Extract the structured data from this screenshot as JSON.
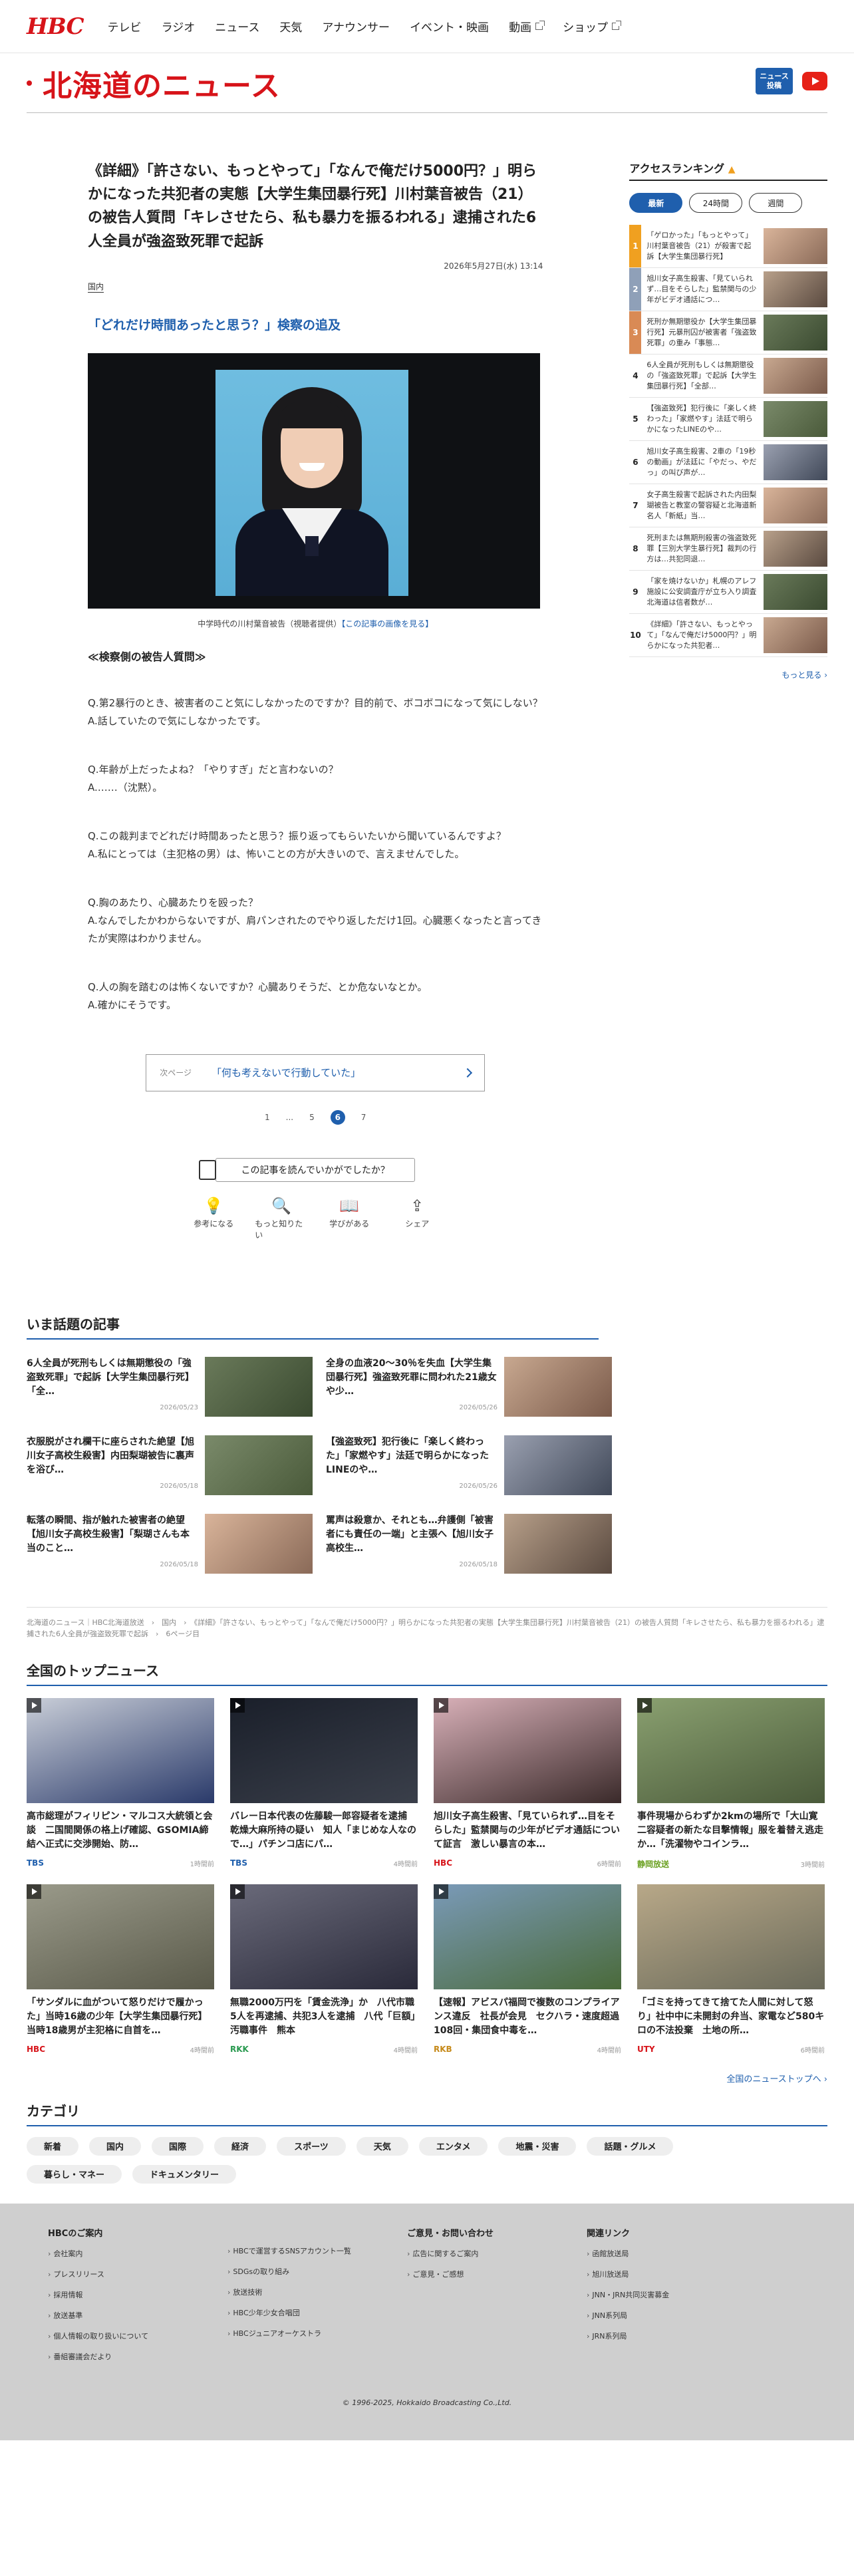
{
  "gnav": {
    "logo": "HBC",
    "items": [
      "テレビ",
      "ラジオ",
      "ニュース",
      "天気",
      "アナウンサー",
      "イベント・映画",
      "動画",
      "ショップ"
    ]
  },
  "section": {
    "title": "北海道のニュース",
    "badge_line1": "ニュース",
    "badge_line2": "投稿"
  },
  "article": {
    "title": "《詳細》「許さない、もっとやって」「なんで俺だけ5000円？」明らかになった共犯者の実態【大学生集団暴行死】川村葉音被告（21）の被告人質問「キレさせたら、私も暴力を振るわれる」逮捕された6人全員が強盗致死罪で起訴",
    "date": "2026年5月27日(水) 13:14",
    "category": "国内",
    "subtitle": "「どれだけ時間あったと思う？」検察の追及",
    "caption_text": "中学時代の川村葉音被告（視聴者提供）",
    "caption_link": "【この記事の画像を見る】",
    "qa_heading": "≪検察側の被告人質問≫",
    "qa": [
      {
        "q": "Q.第2暴行のとき、被害者のこと気にしなかったのですか？目的前で、ボコボコになって気にしない？",
        "a": "A.話していたので気にしなかったです。"
      },
      {
        "q": "Q.年齢が上だったよね？「やりすぎ」だと言わないの？",
        "a": "A.……（沈黙）。"
      },
      {
        "q": "Q.この裁判までどれだけ時間あったと思う？振り返ってもらいたいから聞いているんですよ？",
        "a": "A.私にとっては（主犯格の男）は、怖いことの方が大きいので、言えませんでした。"
      },
      {
        "q": "Q.胸のあたり、心臓あたりを殴った？",
        "a": "A.なんでしたかわからないですが、肩パンされたのでやり返しただけ1回。心臓悪くなったと言ってきたが実際はわかりません。"
      },
      {
        "q": "Q.人の胸を踏むのは怖くないですか？心臓ありそうだ、とか危ないなとか。",
        "a": "A.確かにそうです。"
      }
    ],
    "next_label": "次ページ",
    "next_title": "「何も考えないで行動していた」",
    "pager": [
      "1",
      "...",
      "5",
      "6",
      "7"
    ],
    "pager_current": "6",
    "feedback": "この記事を読んでいかがでしたか？",
    "reactions": [
      {
        "icon": "💡",
        "label": "参考になる"
      },
      {
        "icon": "🔍",
        "label": "もっと知りたい"
      },
      {
        "icon": "📖",
        "label": "学びがある"
      },
      {
        "icon": "⇪",
        "label": "シェア"
      }
    ]
  },
  "ranking": {
    "title": "アクセスランキング",
    "tabs": [
      "最新",
      "24時間",
      "週間"
    ],
    "items": [
      {
        "num": "1",
        "text": "「ゲロかった」「もっとやって」川村葉音被告（21）が殺害で起訴【大学生集団暴行死】",
        "color": "#f0a020"
      },
      {
        "num": "2",
        "text": "旭川女子高生殺害、「見ていられず…目をそらした」監禁関与の少年がビデオ通話につ…",
        "color": "#8fa0b8"
      },
      {
        "num": "3",
        "text": "死刑か無期懲役か【大学生集団暴行死】元暴刑囚が被害者「強盗致死罪」の重み「事態…",
        "color": "#d98a55"
      },
      {
        "num": "4",
        "text": "6人全員が死刑もしくは無期懲役の「強盗致死罪」で起訴【大学生集団暴行死】「全部…",
        "color": ""
      },
      {
        "num": "5",
        "text": "【強盗致死】犯行後に「楽しく終わった」「家燃やす」法廷で明らかになったLINEのや…",
        "color": ""
      },
      {
        "num": "6",
        "text": "旭川女子高生殺害、2車の「19秒の動画」が法廷に「やだっ、やだっ」の叫び声が…",
        "color": ""
      },
      {
        "num": "7",
        "text": "女子高生殺害で起訴された内田梨瑚被告と教室の警容疑と北海道新名人「新紙」当…",
        "color": ""
      },
      {
        "num": "8",
        "text": "死刑または無期刑殺害の強盗致死罪【三別大学生暴行死】裁判の行方は…共犯同退…",
        "color": ""
      },
      {
        "num": "9",
        "text": "「家を焼けないか」札幌のアレフ施設に公安調査庁が立ち入り調査 北海道は信者数が…",
        "color": ""
      },
      {
        "num": "10",
        "text": "《詳細》「許さない、もっとやって」「なんで俺だけ5000円？」明らかになった共犯者…",
        "color": ""
      }
    ],
    "more": "もっと見る ›"
  },
  "hot": {
    "title": "いま話題の記事",
    "items": [
      {
        "text": "6人全員が死刑もしくは無期懲役の「強盗致死罪」で起訴【大学生集団暴行死】「全…",
        "date": "2026/05/23"
      },
      {
        "text": "全身の血液20～30％を失血【大学生集団暴行死】強盗致死罪に問われた21歳女や少…",
        "date": "2026/05/26"
      },
      {
        "text": "衣服脱がされ欄干に座らされた絶望【旭川女子高校生殺害】内田梨瑚被告に裏声を浴び…",
        "date": "2026/05/18"
      },
      {
        "text": "【強盗致死】犯行後に「楽しく終わった」「家燃やす」法廷で明らかになったLINEのや…",
        "date": "2026/05/26"
      },
      {
        "text": "転落の瞬間、指が触れた被害者の絶望【旭川女子高校生殺害】「梨瑚さんも本当のこと…",
        "date": "2026/05/18"
      },
      {
        "text": "罵声は殺意か、それとも…弁護側「被害者にも責任の一端」と主張へ【旭川女子高校生…",
        "date": "2026/05/18"
      }
    ]
  },
  "breadcrumb": "北海道のニュース｜HBC北海道放送　›　国内　›　《詳細》「許さない、もっとやって」「なんで俺だけ5000円？」明らかになった共犯者の実態【大学生集団暴行死】川村葉音被告（21）の被告人質問「キレさせたら、私も暴力を振るわれる」逮捕された6人全員が強盗致死罪で起訴　›　6ページ目",
  "tops": {
    "title": "全国のトップニュース",
    "items": [
      {
        "title": "高市総理がフィリピン・マルコス大統領と会談　二国間関係の格上げ確認、GSOMIA締結へ正式に交渉開始、防…",
        "src": "TBS",
        "ago": "1時間前",
        "srccolor": "#1f5fad"
      },
      {
        "title": "バレー日本代表の佐藤駿一郎容疑者を逮捕　乾燥大麻所持の疑い　知人「まじめな人なので…」パチンコ店にパ…",
        "src": "TBS",
        "ago": "4時間前",
        "srccolor": "#1f5fad"
      },
      {
        "title": "旭川女子高生殺害、「見ていられず…目をそらした」監禁関与の少年がビデオ通話について証言　激しい暴言の本…",
        "src": "HBC",
        "ago": "6時間前",
        "srccolor": "#d7141a"
      },
      {
        "title": "事件現場からわずか2kmの場所で「大山寛二容疑者の新たな目撃情報」服を着替え逃走か…「洗濯物やコインラ…",
        "src": "静岡放送",
        "ago": "3時間前",
        "srccolor": "#6aa020"
      },
      {
        "title": "「サンダルに血がついて怒りだけで履かった」当時16歳の少年【大学生集団暴行死】当時18歳男が主犯格に自首を…",
        "src": "HBC",
        "ago": "4時間前",
        "srccolor": "#d7141a"
      },
      {
        "title": "無職2000万円を「賃金洗浄」か　八代市職5人を再逮捕、共犯3人を逮捕　八代「巨額」汚職事件　熊本",
        "src": "RKK",
        "ago": "4時間前",
        "srccolor": "#2a9a50"
      },
      {
        "title": "【速報】アビスパ福岡で複数のコンプライアンス違反　社長が会見　セクハラ・速度超過108回・集団食中毒を…",
        "src": "RKB",
        "ago": "4時間前",
        "srccolor": "#c68a1a"
      },
      {
        "title": "「ゴミを持ってきて捨てた人間に対して怒り」社中中に未開封の弁当、家電など580キロの不法投棄　土地の所…",
        "src": "UTY",
        "ago": "6時間前",
        "srccolor": "#d7141a"
      }
    ],
    "more": "全国のニューストップへ ›"
  },
  "cats": {
    "title": "カテゴリ",
    "items": [
      "新着",
      "国内",
      "国際",
      "経済",
      "スポーツ",
      "天気",
      "エンタメ",
      "地震・災害",
      "話題・グルメ",
      "暮らし・マネー",
      "ドキュメンタリー"
    ]
  },
  "footer": {
    "cols": [
      {
        "head": "HBCのご案内",
        "links": [
          "会社案内",
          "プレスリリース",
          "採用情報",
          "放送基準",
          "個人情報の取り扱いについて",
          "番組審議会だより"
        ]
      },
      {
        "head": "",
        "links": [
          "HBCで運営するSNSアカウント一覧",
          "SDGsの取り組み",
          "放送技術",
          "HBC少年少女合唱団",
          "HBCジュニアオーケストラ"
        ]
      },
      {
        "head": "ご意見・お問い合わせ",
        "links": [
          "広告に関するご案内",
          "ご意見・ご感想"
        ]
      },
      {
        "head": "関連リンク",
        "links": [
          "函館放送局",
          "旭川放送局",
          "JNN・JRN共同災害募金",
          "JNN系列局",
          "JRN系列局"
        ]
      }
    ],
    "copyright": "© 1996-2025, Hokkaido Broadcasting Co.,Ltd."
  }
}
